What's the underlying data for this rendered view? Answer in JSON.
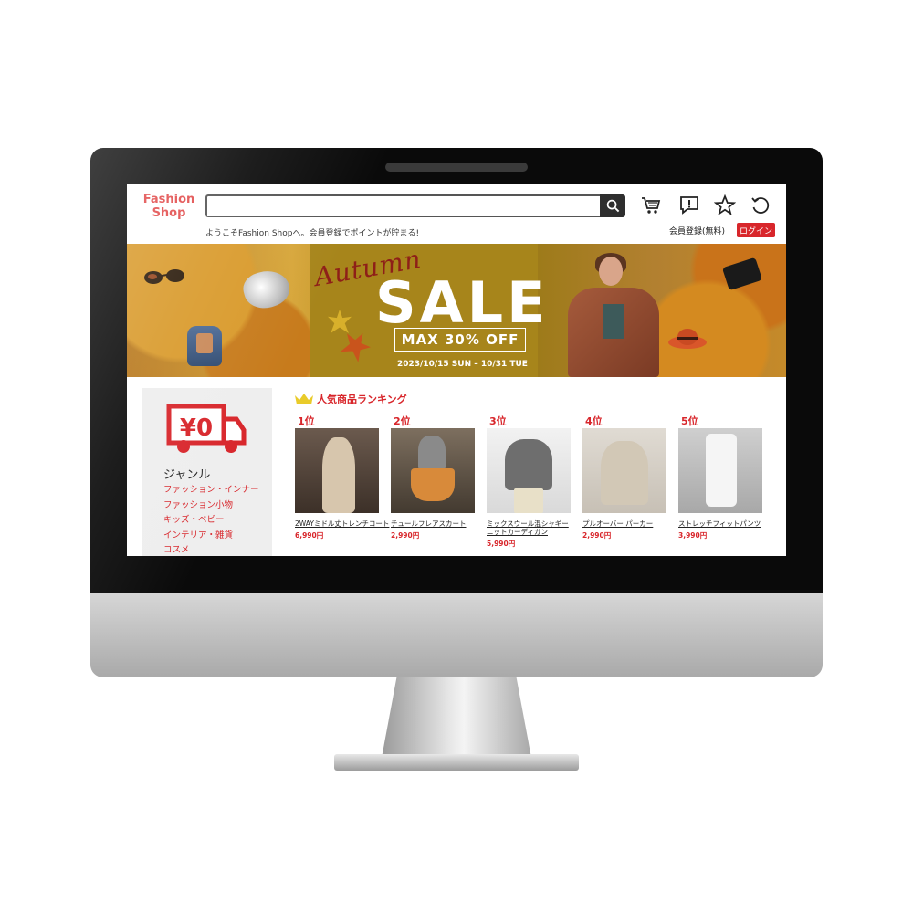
{
  "header": {
    "logo": "Fashion Shop",
    "search_placeholder": "",
    "welcome": "ようこそFashion Shopへ。会員登録でポイントが貯まる!",
    "member_register": "会員登録(無料)",
    "login": "ログイン",
    "icons": [
      "search-icon",
      "cart-icon",
      "message-icon",
      "star-icon",
      "history-icon"
    ]
  },
  "banner": {
    "script_text": "Autumn",
    "headline": "SALE",
    "discount": "MAX 30% OFF",
    "period": "2023/10/15 SUN – 10/31 TUE"
  },
  "sidebar": {
    "shipping_badge": "¥0",
    "genre_title": "ジャンル",
    "genres": [
      "ファッション・インナー",
      "ファッション小物",
      "キッズ・ベビー",
      "インテリア・雑貨",
      "コスメ"
    ]
  },
  "ranking": {
    "title": "人気商品ランキング",
    "products": [
      {
        "rank": "1位",
        "name": "2WAYミドル丈トレンチコート",
        "price": "6,990円"
      },
      {
        "rank": "2位",
        "name": "チュールフレアスカート",
        "price": "2,990円"
      },
      {
        "rank": "3位",
        "name": "ミックスウール混シャギーニットカーディガン",
        "name_line2": "",
        "price": "5,990円"
      },
      {
        "rank": "4位",
        "name": "プルオーバー パーカー",
        "price": "2,990円"
      },
      {
        "rank": "5位",
        "name": "ストレッチフィットパンツ",
        "price": "3,990円"
      }
    ]
  },
  "colors": {
    "accent": "#d8262b",
    "logo": "#e24b4b",
    "banner_gold": "#a7851b"
  }
}
